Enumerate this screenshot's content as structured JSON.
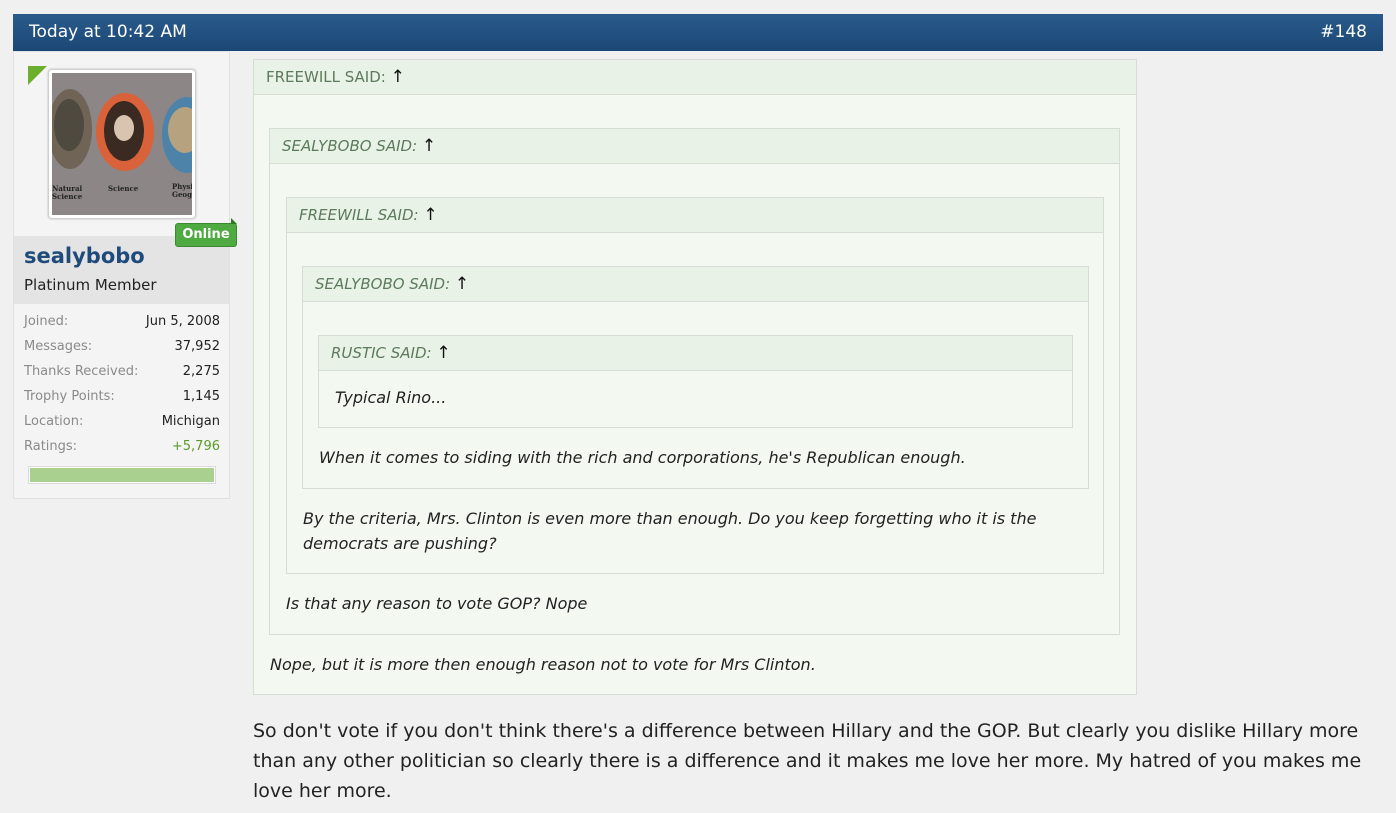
{
  "header": {
    "date": "Today at 10:42 AM",
    "post_number": "#148"
  },
  "user": {
    "name": "sealybobo",
    "title": "Platinum Member",
    "online_badge": "Online",
    "avatar_captions": [
      "Natural Science",
      "Science",
      "Physi Geogr"
    ],
    "stats": [
      {
        "label": "Joined:",
        "value": "Jun 5, 2008"
      },
      {
        "label": "Messages:",
        "value": "37,952"
      },
      {
        "label": "Thanks Received:",
        "value": "2,275"
      },
      {
        "label": "Trophy Points:",
        "value": "1,145"
      },
      {
        "label": "Location:",
        "value": "Michigan"
      },
      {
        "label": "Ratings:",
        "value": "+5,796"
      }
    ],
    "rating_fill_percent": 100,
    "colors": {
      "rating_positive": "#5a9a2a",
      "online": "#4faa41",
      "username": "#1f4b7b"
    }
  },
  "quotes": {
    "q1": {
      "header": "FREEWILL SAID:",
      "arrow": "↑",
      "text": "Nope, but it is more then enough reason not to vote for Mrs Clinton."
    },
    "q2": {
      "header": "SEALYBOBO SAID:",
      "arrow": "↑",
      "text": "Is that any reason to vote GOP? Nope"
    },
    "q3": {
      "header": "FREEWILL SAID:",
      "arrow": "↑",
      "text_line1": "By the criteria, Mrs. Clinton is even more than enough. Do you keep forgetting who it is the",
      "text_line2": "democrats are pushing?"
    },
    "q4": {
      "header": "SEALYBOBO SAID:",
      "arrow": "↑",
      "text": "When it comes to siding with the rich and corporations, he's Republican enough."
    },
    "q5": {
      "header": "RUSTIC SAID:",
      "arrow": "↑",
      "text": "Typical Rino..."
    }
  },
  "message": {
    "line1": "So don't vote if you don't think there's a difference between Hillary and the GOP. But clearly you dislike Hillary more",
    "line2": "than any other politician so clearly there is a difference and it makes me love her more. My hatred of you makes me",
    "line3": "love her more."
  }
}
